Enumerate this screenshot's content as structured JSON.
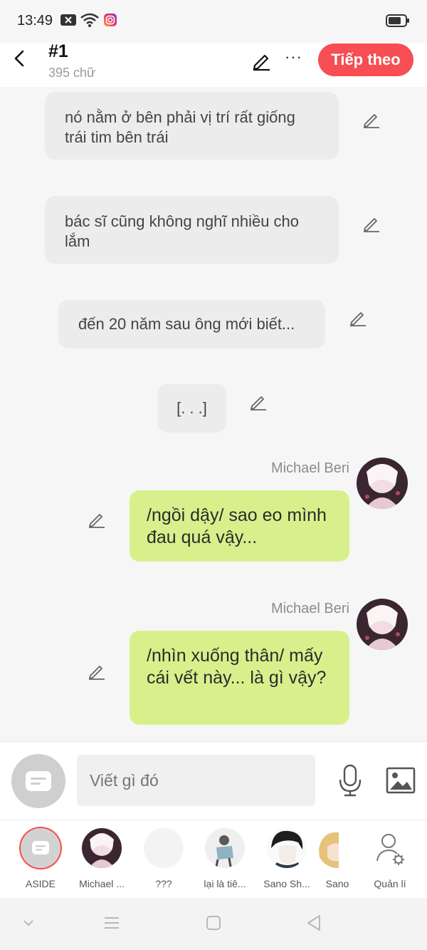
{
  "status_bar": {
    "time": "13:49"
  },
  "header": {
    "title": "#1",
    "word_count": "395 chữ",
    "more_label": "···",
    "next_button": "Tiếp theo"
  },
  "narration": [
    {
      "text": "nó nằm ở bên phải vị trí rất giống trái tim bên trái"
    },
    {
      "text": "bác sĩ cũng không nghĩ nhiều cho lắm"
    },
    {
      "text": "đến 20 năm sau ông mới biết..."
    },
    {
      "text": "[. . .]"
    }
  ],
  "messages": [
    {
      "sender": "Michael Beri",
      "text": "/ngồi dậy/ sao eo mình đau quá vậy..."
    },
    {
      "sender": "Michael Beri",
      "text": "/nhìn xuống thân/ mấy cái vết này... là gì vậy?"
    }
  ],
  "composer": {
    "placeholder": "Viết gì đó"
  },
  "characters": [
    {
      "label": "ASIDE"
    },
    {
      "label": "Michael ..."
    },
    {
      "label": "???"
    },
    {
      "label": "lại là tiê..."
    },
    {
      "label": "Sano Sh..."
    },
    {
      "label": "Sano"
    },
    {
      "label": "Quản lí"
    }
  ],
  "colors": {
    "accent": "#f64e52",
    "bubble_green": "#d8f08c",
    "narration_bg": "#ececec"
  },
  "icons": [
    "back-icon",
    "pencil-icon",
    "more-icon",
    "microphone-icon",
    "image-icon",
    "manage-characters-icon"
  ]
}
